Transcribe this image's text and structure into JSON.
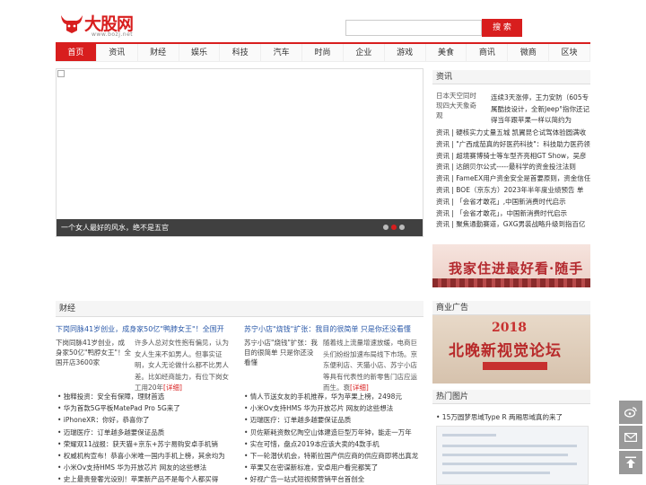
{
  "header": {
    "logo_text": "大股网",
    "logo_url": "www.bozj.net",
    "search_placeholder": "",
    "search_button": "搜 索"
  },
  "nav": [
    "首页",
    "资讯",
    "财经",
    "娱乐",
    "科技",
    "汽车",
    "时尚",
    "企业",
    "游戏",
    "美食",
    "商讯",
    "微商",
    "区块"
  ],
  "slider": {
    "caption": "一个女人最好的风水，绝不是五官"
  },
  "news": {
    "heading": "资讯",
    "feature_img_alt": "日本天空同时现四大天象奇观",
    "feature_text": "连续3天涨停，王力安防（605专属酷技设计，全新Jeep°指你还记得当年跟苹果一样以简约为",
    "items": [
      "资讯 | 硬核实力丈量五城 凯翼昆仑试驾体验圆满收",
      "资讯 | \"广西成茄真的好医药科技\"：科技助力医药领域",
      "资讯 | 超境赛博骑士等车型齐亮相GT Show，吴彦",
      "资讯 | 达朗贝尔公式-----最科学的资金投注法则",
      "资讯 | FameEX用户资金安全是首要原则，资金信任",
      "资讯 | BOE（京东方）2023年半年度业绩预告 单",
      "资讯 | 「会省才敢花」,中国新消费时代启示",
      "资讯 | 「会省才敢花」，中国新消费时代启示",
      "资讯 | 聚焦通勤赛道，GXG男装战略升级到指百亿"
    ]
  },
  "banner1": {
    "text": "我家住进最好看·随手拍"
  },
  "ad": {
    "heading": "商业广告",
    "year": "2018",
    "text": "北晚新视觉论坛"
  },
  "finance": {
    "heading": "财经",
    "left": {
      "title": "下岗同脉41岁创业，成身家50亿\"鸭脖女王\"！全国开",
      "img_alt": "下岗同脉41岁创业，成身家50亿\"鸭脖女王\"！全国开店3600家",
      "desc": "许多人总对女性抱有偏见，认为女人生来不如男人。但事实证明，女人无论做什么都不比男人差。比如经商能力，有位下岗女工用20年",
      "more": "[详细]",
      "items": [
        "• 独释投资：安全有保障，理财首选",
        "• 华为首款5G平板MatePad Pro 5G来了",
        "• iPhoneXR：你好，恭喜你了",
        "• 迈瑞医疗：订单越多越要保证品质",
        "• 荣耀双11战报：获天猫+京东+苏宁易购安卓手机销",
        "• 权威机构宣布！恭喜小米唯一国内手机上榜，其余均为",
        "• 小米Ov支持HMS 华为开放芯片 网友的这些想法",
        "• 史上最贵登奢光设别！苹果新产品不是每个人都买得"
      ]
    },
    "right": {
      "title": "苏宁小店\"烧钱\"扩张：我目的很简单 只是你还没看懂",
      "img_alt": "苏宁小店\"烧钱\"扩张：我目的很简单 只是你还没看懂",
      "desc": "随着线上流量增速放缓，电商巨头们纷纷加速布局线下市场。京东便利店、天猫小店、苏宁小店等具有代表性的新零售门店应运而生。衰",
      "more": "[详细]",
      "items": [
        "• 情人节送女友的手机推荐，华为苹果上榜，2498元",
        "• 小米Ov支持HMS 华为开放芯片 网友的这些想法",
        "• 迈瑞医疗：订单越多越要保证品质",
        "• 贝佐斯耗资数亿陶空山体建造巨型万年钟，能走一万年",
        "• 实在可惜，盘点2019本应该大卖的4款手机",
        "• 下一轮潜伏机会，特斯拉国产供应商的供应商即将出真龙",
        "• 苹果又在密谋新标准，安卓用户看完都笑了",
        "• 好视广告一站式短视频营销平台首创全"
      ]
    }
  },
  "hot": {
    "heading": "热门图片",
    "first_item": "• 15万圆梦思域Type R 两厢思域真的来了"
  },
  "float": {
    "weibo_icon": "weibo-icon",
    "mail_icon": "mail-icon",
    "top_icon": "back-to-top-icon"
  }
}
